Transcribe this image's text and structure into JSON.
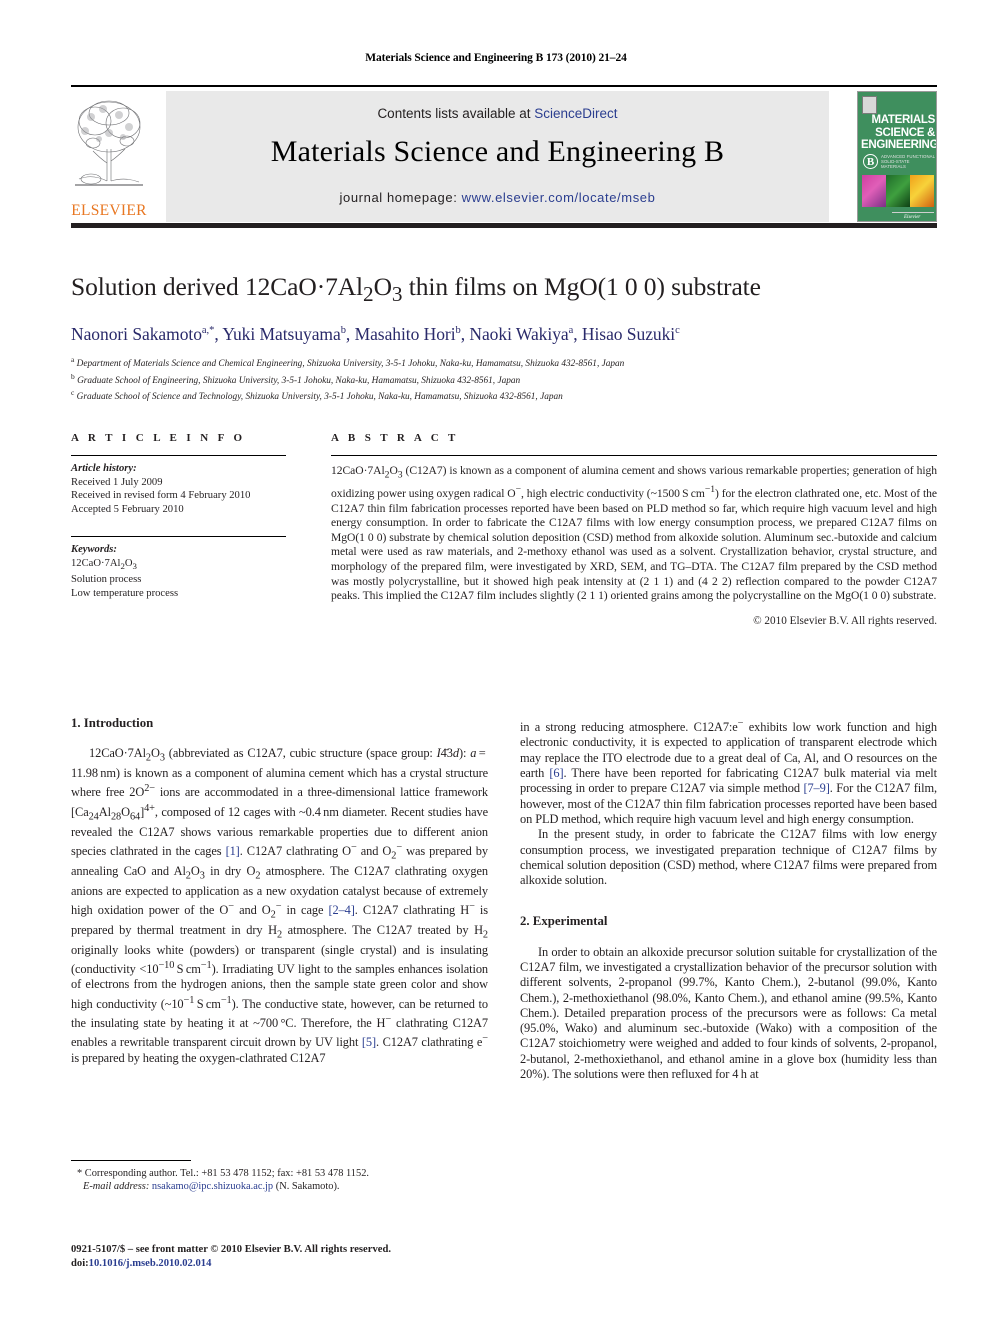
{
  "running_head": "Materials Science and Engineering B 173 (2010) 21–24",
  "masthead": {
    "contents_prefix": "Contents lists available at ",
    "sciencedirect": "ScienceDirect",
    "journal_title": "Materials Science and Engineering B",
    "homepage_label": "journal homepage:",
    "homepage_url": "www.elsevier.com/locate/mseb",
    "publisher_logo_text": "ELSEVIER",
    "cover": {
      "line1": "MATERIALS",
      "line2": "SCIENCE &",
      "line3": "ENGINEERING",
      "series_letter": "B",
      "series_sub": "ADVANCED FUNCTIONAL SOLID-STATE MATERIALS",
      "footer_mark": "Elsevier"
    },
    "accent_orange": "#e87722",
    "link_blue": "#2a3d8f",
    "banner_gray": "#e9e9e9",
    "cover_green": "#3f8f5e"
  },
  "article": {
    "title_parts": {
      "a": "Solution derived 12CaO·7Al",
      "sub1": "2",
      "b": "O",
      "sub2": "3",
      "c": " thin films on MgO(1 0 0) substrate"
    },
    "title_plain": "Solution derived 12CaO·7Al2O3 thin films on MgO(1 0 0) substrate",
    "authors": [
      {
        "name": "Naonori Sakamoto",
        "marks": "a,*"
      },
      {
        "name": "Yuki Matsuyama",
        "marks": "b"
      },
      {
        "name": "Masahito Hori",
        "marks": "b"
      },
      {
        "name": "Naoki Wakiya",
        "marks": "a"
      },
      {
        "name": "Hisao Suzuki",
        "marks": "c"
      }
    ],
    "affiliations": [
      {
        "mark": "a",
        "text": "Department of Materials Science and Chemical Engineering, Shizuoka University, 3-5-1 Johoku, Naka-ku, Hamamatsu, Shizuoka 432-8561, Japan"
      },
      {
        "mark": "b",
        "text": "Graduate School of Engineering, Shizuoka University, 3-5-1 Johoku, Naka-ku, Hamamatsu, Shizuoka 432-8561, Japan"
      },
      {
        "mark": "c",
        "text": "Graduate School of Science and Technology, Shizuoka University, 3-5-1 Johoku, Naka-ku, Hamamatsu, Shizuoka 432-8561, Japan"
      }
    ]
  },
  "article_info": {
    "heading": "A R T I C L E  I N F O",
    "history_label": "Article history:",
    "history": [
      "Received 1 July 2009",
      "Received in revised form 4 February 2010",
      "Accepted 5 February 2010"
    ],
    "keywords_label": "Keywords:",
    "keywords": [
      "12CaO·7Al2O3",
      "Solution process",
      "Low temperature process"
    ]
  },
  "abstract": {
    "heading": "A B S T R A C T",
    "copyright": "© 2010 Elsevier B.V. All rights reserved."
  },
  "sections": {
    "intro_heading": "1.  Introduction",
    "experimental_heading": "2.  Experimental"
  },
  "footnote": {
    "corresponding": "* Corresponding author. Tel.: +81 53 478 1152; fax: +81 53 478 1152.",
    "email_label": "E-mail address:",
    "email": "nsakamo@ipc.shizuoka.ac.jp",
    "email_owner": "(N. Sakamoto).",
    "issn_line": "0921-5107/$ – see front matter © 2010 Elsevier B.V. All rights reserved.",
    "doi_label": "doi:",
    "doi": "10.1016/j.mseb.2010.02.014"
  }
}
